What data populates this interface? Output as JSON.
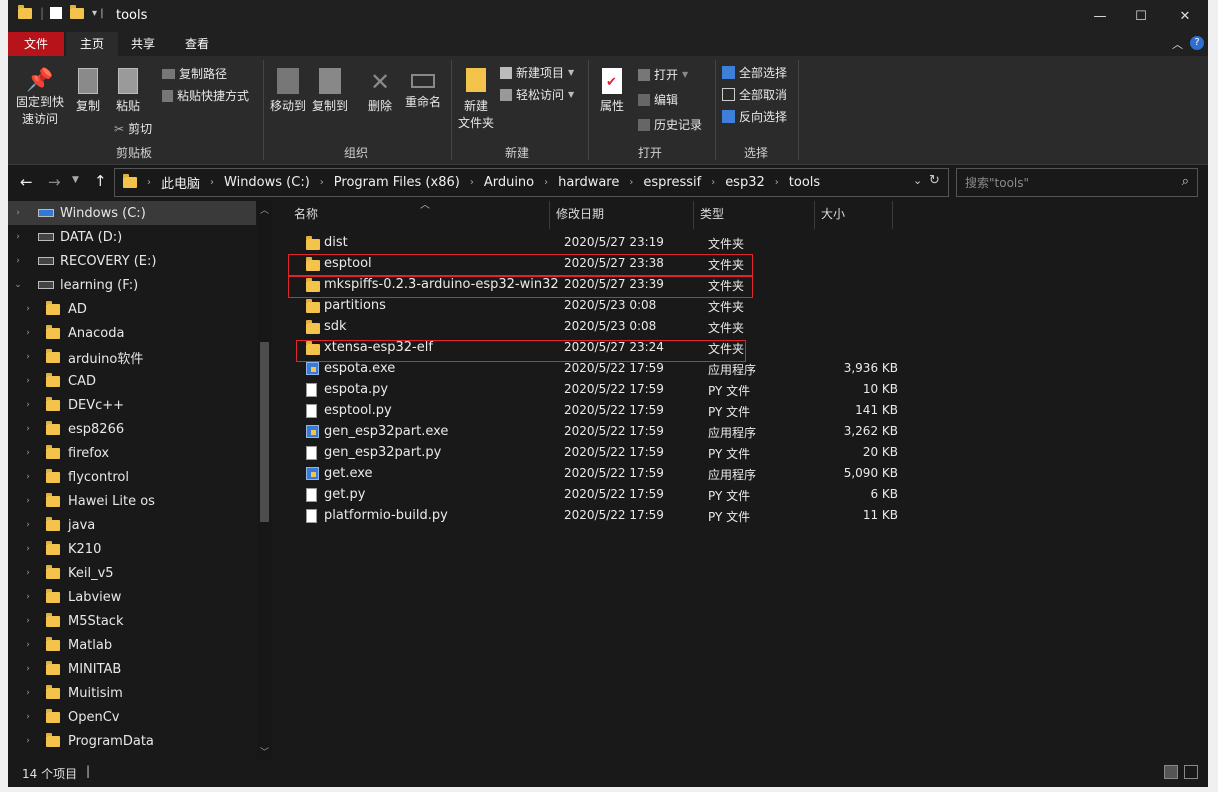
{
  "window": {
    "title": "tools",
    "min_glyph": "—",
    "max_glyph": "☐",
    "close_glyph": "✕"
  },
  "tabs": [
    "文件",
    "主页",
    "共享",
    "查看"
  ],
  "ribbon": {
    "clipboard": {
      "pin": "固定到快\n速访问",
      "copy": "复制",
      "paste": "粘贴",
      "copy_path": "复制路径",
      "paste_shortcut": "粘贴快捷方式",
      "cut": "剪切",
      "label": "剪贴板"
    },
    "organize": {
      "move_to": "移动到",
      "copy_to": "复制到",
      "delete": "删除",
      "rename": "重命名",
      "label": "组织"
    },
    "new": {
      "new_folder": "新建\n文件夹",
      "new_item": "新建项目",
      "easy_access": "轻松访问",
      "label": "新建"
    },
    "open": {
      "properties": "属性",
      "open": "打开",
      "edit": "编辑",
      "history": "历史记录",
      "label": "打开"
    },
    "select": {
      "select_all": "全部选择",
      "select_none": "全部取消",
      "invert": "反向选择",
      "label": "选择"
    }
  },
  "breadcrumb": [
    "此电脑",
    "Windows (C:)",
    "Program Files (x86)",
    "Arduino",
    "hardware",
    "espressif",
    "esp32",
    "tools"
  ],
  "search": {
    "placeholder": "搜索\"tools\""
  },
  "nav": {
    "drives": [
      "Windows (C:)",
      "DATA (D:)",
      "RECOVERY (E:)",
      "learning (F:)"
    ],
    "folders": [
      "AD",
      "Anacoda",
      "arduino软件",
      "CAD",
      "DEVc++",
      "esp8266",
      "firefox",
      "flycontrol",
      "Hawei Lite os",
      "java",
      "K210",
      "Keil_v5",
      "Labview",
      "M5Stack",
      "Matlab",
      "MINITAB",
      "Muitisim",
      "OpenCv",
      "ProgramData"
    ]
  },
  "columns": {
    "name": "名称",
    "date": "修改日期",
    "type": "类型",
    "size": "大小"
  },
  "files": [
    {
      "name": "dist",
      "date": "2020/5/27 23:19",
      "type": "文件夹",
      "size": "",
      "kind": "folder"
    },
    {
      "name": "esptool",
      "date": "2020/5/27 23:38",
      "type": "文件夹",
      "size": "",
      "kind": "folder"
    },
    {
      "name": "mkspiffs-0.2.3-arduino-esp32-win32",
      "date": "2020/5/27 23:39",
      "type": "文件夹",
      "size": "",
      "kind": "folder"
    },
    {
      "name": "partitions",
      "date": "2020/5/23 0:08",
      "type": "文件夹",
      "size": "",
      "kind": "folder"
    },
    {
      "name": "sdk",
      "date": "2020/5/23 0:08",
      "type": "文件夹",
      "size": "",
      "kind": "folder"
    },
    {
      "name": "xtensa-esp32-elf",
      "date": "2020/5/27 23:24",
      "type": "文件夹",
      "size": "",
      "kind": "folder"
    },
    {
      "name": "espota.exe",
      "date": "2020/5/22 17:59",
      "type": "应用程序",
      "size": "3,936 KB",
      "kind": "exe"
    },
    {
      "name": "espota.py",
      "date": "2020/5/22 17:59",
      "type": "PY 文件",
      "size": "10 KB",
      "kind": "doc"
    },
    {
      "name": "esptool.py",
      "date": "2020/5/22 17:59",
      "type": "PY 文件",
      "size": "141 KB",
      "kind": "doc"
    },
    {
      "name": "gen_esp32part.exe",
      "date": "2020/5/22 17:59",
      "type": "应用程序",
      "size": "3,262 KB",
      "kind": "exe"
    },
    {
      "name": "gen_esp32part.py",
      "date": "2020/5/22 17:59",
      "type": "PY 文件",
      "size": "20 KB",
      "kind": "doc"
    },
    {
      "name": "get.exe",
      "date": "2020/5/22 17:59",
      "type": "应用程序",
      "size": "5,090 KB",
      "kind": "exe"
    },
    {
      "name": "get.py",
      "date": "2020/5/22 17:59",
      "type": "PY 文件",
      "size": "6 KB",
      "kind": "doc"
    },
    {
      "name": "platformio-build.py",
      "date": "2020/5/22 17:59",
      "type": "PY 文件",
      "size": "11 KB",
      "kind": "doc"
    }
  ],
  "status": {
    "count": "14 个项目"
  },
  "colors": {
    "file_tab": "#b7131a",
    "highlight": "#e0242c",
    "folder": "#f3c34b"
  }
}
